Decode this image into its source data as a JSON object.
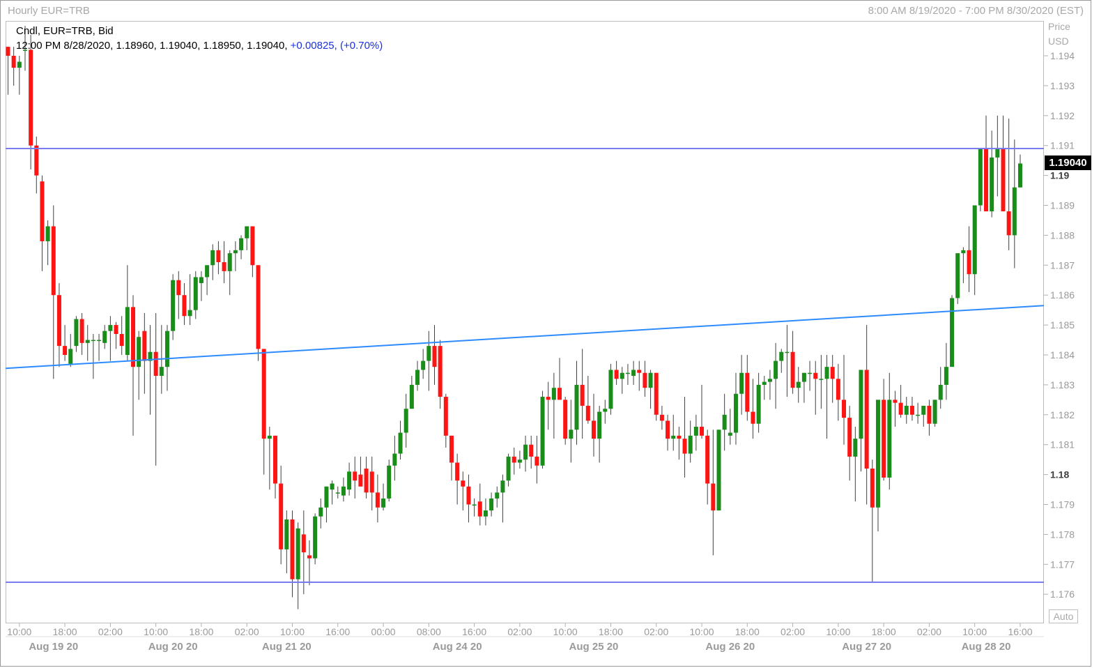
{
  "header": {
    "title": "Hourly EUR=TRB",
    "date_range": "8:00 AM 8/19/2020 - 7:00 PM 8/30/2020 (EST)"
  },
  "info": {
    "line1": "Cndl, EUR=TRB, Bid",
    "line2_prefix": "12:00 PM 8/28/2020, 1.18960, 1.19040, 1.18950, 1.19040,",
    "line2_change": "+0.00825, (+0.70%)"
  },
  "axis": {
    "price_label": "Price",
    "currency_label": "USD",
    "last_price": "1.19040",
    "auto_label": "Auto"
  },
  "colors": {
    "up": "#1a8c1a",
    "down": "#ff1414",
    "hline": "#7b7bf0",
    "trend": "#2e8bff"
  },
  "chart_data": {
    "type": "candlestick",
    "title": "Hourly EUR=TRB",
    "ylabel": "Price USD",
    "ylim": [
      1.1755,
      1.1948
    ],
    "y_ticks": [
      "1.176",
      "1.177",
      "1.178",
      "1.179",
      "1.18",
      "1.181",
      "1.182",
      "1.183",
      "1.184",
      "1.185",
      "1.186",
      "1.187",
      "1.188",
      "1.189",
      "1.19",
      "1.191",
      "1.192",
      "1.193",
      "1.194"
    ],
    "y_ticks_bold": [
      "1.18",
      "1.19"
    ],
    "x_ticks": [
      {
        "i": 2,
        "label": "10:00"
      },
      {
        "i": 10,
        "label": "18:00"
      },
      {
        "i": 18,
        "label": "02:00"
      },
      {
        "i": 26,
        "label": "10:00"
      },
      {
        "i": 34,
        "label": "18:00"
      },
      {
        "i": 42,
        "label": "02:00"
      },
      {
        "i": 50,
        "label": "10:00"
      },
      {
        "i": 58,
        "label": "16:00"
      },
      {
        "i": 66,
        "label": "00:00"
      },
      {
        "i": 74,
        "label": "08:00"
      },
      {
        "i": 82,
        "label": "16:00"
      },
      {
        "i": 90,
        "label": "02:00"
      },
      {
        "i": 98,
        "label": "10:00"
      },
      {
        "i": 106,
        "label": "18:00"
      },
      {
        "i": 114,
        "label": "02:00"
      },
      {
        "i": 122,
        "label": "10:00"
      },
      {
        "i": 130,
        "label": "18:00"
      },
      {
        "i": 138,
        "label": "02:00"
      },
      {
        "i": 146,
        "label": "10:00"
      },
      {
        "i": 154,
        "label": "18:00"
      },
      {
        "i": 162,
        "label": "02:00"
      },
      {
        "i": 170,
        "label": "10:00"
      },
      {
        "i": 178,
        "label": "16:00"
      }
    ],
    "x_dates": [
      {
        "i": 8,
        "label": "Aug 19 20"
      },
      {
        "i": 29,
        "label": "Aug 20 20"
      },
      {
        "i": 49,
        "label": "Aug 21 20"
      },
      {
        "i": 79,
        "label": "Aug 24 20"
      },
      {
        "i": 103,
        "label": "Aug 25 20"
      },
      {
        "i": 127,
        "label": "Aug 26 20"
      },
      {
        "i": 151,
        "label": "Aug 27 20"
      },
      {
        "i": 172,
        "label": "Aug 28 20"
      }
    ],
    "horizontal_lines": [
      1.1909,
      1.1764
    ],
    "trend_line": {
      "start": [
        0,
        1.18355
      ],
      "end": [
        181,
        1.18565
      ]
    },
    "candles": [
      [
        1.1943,
        1.1943,
        1.1927,
        1.194
      ],
      [
        1.194,
        1.1943,
        1.193,
        1.1936
      ],
      [
        1.1936,
        1.194,
        1.1927,
        1.1938
      ],
      [
        1.1942,
        1.195,
        1.1935,
        1.1942
      ],
      [
        1.1942,
        1.1947,
        1.1902,
        1.191
      ],
      [
        1.191,
        1.1913,
        1.1894,
        1.19
      ],
      [
        1.1898,
        1.19,
        1.1868,
        1.1878
      ],
      [
        1.1878,
        1.1885,
        1.187,
        1.1883
      ],
      [
        1.1883,
        1.189,
        1.1832,
        1.186
      ],
      [
        1.186,
        1.1864,
        1.1836,
        1.1843
      ],
      [
        1.1843,
        1.185,
        1.1838,
        1.184
      ],
      [
        1.1837,
        1.1847,
        1.1836,
        1.1842
      ],
      [
        1.1843,
        1.1853,
        1.1841,
        1.1852
      ],
      [
        1.1852,
        1.1854,
        1.184,
        1.1844
      ],
      [
        1.1844,
        1.185,
        1.1838,
        1.1845
      ],
      [
        1.1845,
        1.1847,
        1.1832,
        1.1845
      ],
      [
        1.1845,
        1.1847,
        1.1838,
        1.1845
      ],
      [
        1.1844,
        1.185,
        1.1842,
        1.1848
      ],
      [
        1.1848,
        1.1853,
        1.1838,
        1.185
      ],
      [
        1.185,
        1.1851,
        1.1842,
        1.1847
      ],
      [
        1.1847,
        1.1853,
        1.184,
        1.1843
      ],
      [
        1.184,
        1.187,
        1.1838,
        1.1856
      ],
      [
        1.1856,
        1.186,
        1.1813,
        1.1836
      ],
      [
        1.1836,
        1.1848,
        1.1825,
        1.1846
      ],
      [
        1.1848,
        1.1854,
        1.1827,
        1.1838
      ],
      [
        1.1838,
        1.185,
        1.182,
        1.1841
      ],
      [
        1.1841,
        1.1854,
        1.1803,
        1.1833
      ],
      [
        1.1833,
        1.185,
        1.1827,
        1.1836
      ],
      [
        1.1836,
        1.185,
        1.1828,
        1.1848
      ],
      [
        1.1848,
        1.1867,
        1.1845,
        1.1865
      ],
      [
        1.1865,
        1.1868,
        1.1852,
        1.186
      ],
      [
        1.186,
        1.1864,
        1.185,
        1.1853
      ],
      [
        1.1853,
        1.1867,
        1.185,
        1.1855
      ],
      [
        1.1855,
        1.1868,
        1.1852,
        1.1866
      ],
      [
        1.1864,
        1.1868,
        1.1858,
        1.1866
      ],
      [
        1.1866,
        1.187,
        1.186,
        1.187
      ],
      [
        1.187,
        1.1877,
        1.1865,
        1.1875
      ],
      [
        1.1875,
        1.1878,
        1.1867,
        1.1871
      ],
      [
        1.1871,
        1.1878,
        1.1864,
        1.1868
      ],
      [
        1.1868,
        1.1875,
        1.186,
        1.1874
      ],
      [
        1.1874,
        1.1878,
        1.1868,
        1.1875
      ],
      [
        1.1875,
        1.188,
        1.1872,
        1.1879
      ],
      [
        1.1879,
        1.1883,
        1.1875,
        1.1883
      ],
      [
        1.1883,
        1.1883,
        1.1866,
        1.187
      ],
      [
        1.187,
        1.187,
        1.1838,
        1.1842
      ],
      [
        1.1842,
        1.1842,
        1.18,
        1.1812
      ],
      [
        1.1812,
        1.1816,
        1.1795,
        1.1813
      ],
      [
        1.1813,
        1.1813,
        1.1792,
        1.1797
      ],
      [
        1.1797,
        1.1803,
        1.177,
        1.1775
      ],
      [
        1.1775,
        1.1788,
        1.1767,
        1.1785
      ],
      [
        1.1785,
        1.1788,
        1.1759,
        1.1765
      ],
      [
        1.1765,
        1.1784,
        1.1755,
        1.1782
      ],
      [
        1.178,
        1.1788,
        1.176,
        1.1774
      ],
      [
        1.1773,
        1.1778,
        1.1763,
        1.1772
      ],
      [
        1.1772,
        1.1787,
        1.177,
        1.1786
      ],
      [
        1.1786,
        1.1792,
        1.1782,
        1.1789
      ],
      [
        1.1789,
        1.1796,
        1.1784,
        1.1796
      ],
      [
        1.1795,
        1.1798,
        1.179,
        1.1797
      ],
      [
        1.1794,
        1.1796,
        1.1792,
        1.1794
      ],
      [
        1.1793,
        1.1799,
        1.1791,
        1.1796
      ],
      [
        1.1795,
        1.1804,
        1.1793,
        1.1801
      ],
      [
        1.1801,
        1.1806,
        1.1792,
        1.1798
      ],
      [
        1.18,
        1.1806,
        1.1796,
        1.1796
      ],
      [
        1.1802,
        1.1806,
        1.1792,
        1.1794
      ],
      [
        1.1801,
        1.1806,
        1.1788,
        1.1794
      ],
      [
        1.1794,
        1.18,
        1.1784,
        1.1789
      ],
      [
        1.1789,
        1.1797,
        1.1788,
        1.1792
      ],
      [
        1.1792,
        1.1805,
        1.1791,
        1.1803
      ],
      [
        1.1803,
        1.1813,
        1.1798,
        1.1807
      ],
      [
        1.1807,
        1.1818,
        1.1805,
        1.1814
      ],
      [
        1.1814,
        1.1827,
        1.1809,
        1.1822
      ],
      [
        1.1822,
        1.1833,
        1.1822,
        1.183
      ],
      [
        1.183,
        1.1838,
        1.1828,
        1.1835
      ],
      [
        1.1835,
        1.1842,
        1.1832,
        1.1838
      ],
      [
        1.1838,
        1.1848,
        1.1828,
        1.1843
      ],
      [
        1.1843,
        1.185,
        1.183,
        1.1836
      ],
      [
        1.1843,
        1.1845,
        1.1822,
        1.1826
      ],
      [
        1.1826,
        1.1827,
        1.1809,
        1.1813
      ],
      [
        1.1813,
        1.1813,
        1.1798,
        1.1804
      ],
      [
        1.1804,
        1.1807,
        1.179,
        1.1798
      ],
      [
        1.1798,
        1.1801,
        1.1788,
        1.1796
      ],
      [
        1.1796,
        1.18,
        1.1784,
        1.179
      ],
      [
        1.179,
        1.1792,
        1.1786,
        1.179
      ],
      [
        1.1791,
        1.1797,
        1.1783,
        1.1786
      ],
      [
        1.1786,
        1.1792,
        1.1783,
        1.1788
      ],
      [
        1.1788,
        1.1794,
        1.1786,
        1.1792
      ],
      [
        1.1792,
        1.1796,
        1.1789,
        1.1794
      ],
      [
        1.1794,
        1.18,
        1.1784,
        1.1798
      ],
      [
        1.1798,
        1.1807,
        1.1796,
        1.1806
      ],
      [
        1.1806,
        1.1809,
        1.18,
        1.1804
      ],
      [
        1.1804,
        1.1808,
        1.1802,
        1.1805
      ],
      [
        1.1805,
        1.1813,
        1.1801,
        1.181
      ],
      [
        1.181,
        1.1813,
        1.1802,
        1.1806
      ],
      [
        1.1806,
        1.1813,
        1.1797,
        1.1803
      ],
      [
        1.1803,
        1.1828,
        1.1802,
        1.1826
      ],
      [
        1.1826,
        1.1831,
        1.1815,
        1.1825
      ],
      [
        1.1825,
        1.1834,
        1.1812,
        1.1829
      ],
      [
        1.1829,
        1.1839,
        1.1825,
        1.1825
      ],
      [
        1.1825,
        1.1826,
        1.181,
        1.1812
      ],
      [
        1.1812,
        1.1825,
        1.1804,
        1.1815
      ],
      [
        1.1815,
        1.1838,
        1.181,
        1.183
      ],
      [
        1.183,
        1.1842,
        1.1812,
        1.1823
      ],
      [
        1.1823,
        1.1833,
        1.1817,
        1.1818
      ],
      [
        1.1818,
        1.1827,
        1.1806,
        1.1812
      ],
      [
        1.1812,
        1.1823,
        1.1804,
        1.1821
      ],
      [
        1.1821,
        1.1825,
        1.1817,
        1.1822
      ],
      [
        1.1822,
        1.1837,
        1.182,
        1.1835
      ],
      [
        1.1835,
        1.1838,
        1.183,
        1.1832
      ],
      [
        1.1832,
        1.1836,
        1.1827,
        1.1834
      ],
      [
        1.1834,
        1.1837,
        1.183,
        1.1834
      ],
      [
        1.1833,
        1.1838,
        1.183,
        1.1835
      ],
      [
        1.1835,
        1.1838,
        1.1828,
        1.1834
      ],
      [
        1.1834,
        1.1838,
        1.1826,
        1.1829
      ],
      [
        1.1829,
        1.1835,
        1.1822,
        1.1834
      ],
      [
        1.1834,
        1.1834,
        1.1818,
        1.182
      ],
      [
        1.182,
        1.1823,
        1.1815,
        1.1818
      ],
      [
        1.1818,
        1.182,
        1.1808,
        1.1812
      ],
      [
        1.1812,
        1.182,
        1.1808,
        1.1813
      ],
      [
        1.1813,
        1.1816,
        1.1805,
        1.1812
      ],
      [
        1.1812,
        1.1826,
        1.1799,
        1.1807
      ],
      [
        1.1807,
        1.1818,
        1.1804,
        1.1813
      ],
      [
        1.1813,
        1.182,
        1.1808,
        1.1816
      ],
      [
        1.1816,
        1.183,
        1.1812,
        1.1813
      ],
      [
        1.1813,
        1.1815,
        1.179,
        1.1797
      ],
      [
        1.1797,
        1.1815,
        1.1773,
        1.1788
      ],
      [
        1.1788,
        1.1815,
        1.1788,
        1.1815
      ],
      [
        1.1815,
        1.1827,
        1.1808,
        1.182
      ],
      [
        1.1813,
        1.1822,
        1.181,
        1.1814
      ],
      [
        1.1814,
        1.1834,
        1.181,
        1.1827
      ],
      [
        1.1827,
        1.184,
        1.182,
        1.1834
      ],
      [
        1.1834,
        1.184,
        1.1818,
        1.1821
      ],
      [
        1.1821,
        1.1832,
        1.1812,
        1.1817
      ],
      [
        1.1817,
        1.1834,
        1.1814,
        1.183
      ],
      [
        1.183,
        1.1833,
        1.1825,
        1.1831
      ],
      [
        1.1831,
        1.1835,
        1.1825,
        1.1832
      ],
      [
        1.1832,
        1.1844,
        1.1822,
        1.1838
      ],
      [
        1.1838,
        1.1842,
        1.1834,
        1.1841
      ],
      [
        1.1841,
        1.185,
        1.1826,
        1.1841
      ],
      [
        1.1841,
        1.1848,
        1.1827,
        1.1829
      ],
      [
        1.1829,
        1.1836,
        1.1824,
        1.1831
      ],
      [
        1.1831,
        1.1834,
        1.1824,
        1.1834
      ],
      [
        1.1834,
        1.1838,
        1.1828,
        1.1834
      ],
      [
        1.1834,
        1.1838,
        1.182,
        1.1832
      ],
      [
        1.1832,
        1.184,
        1.1822,
        1.1832
      ],
      [
        1.1832,
        1.184,
        1.1812,
        1.1836
      ],
      [
        1.1836,
        1.184,
        1.1824,
        1.1832
      ],
      [
        1.1832,
        1.1837,
        1.1818,
        1.1825
      ],
      [
        1.1825,
        1.184,
        1.181,
        1.1819
      ],
      [
        1.1819,
        1.1823,
        1.1798,
        1.1806
      ],
      [
        1.1806,
        1.1816,
        1.1791,
        1.1812
      ],
      [
        1.1812,
        1.1835,
        1.1801,
        1.1835
      ],
      [
        1.1835,
        1.185,
        1.179,
        1.1802
      ],
      [
        1.1802,
        1.1805,
        1.1764,
        1.1789
      ],
      [
        1.1789,
        1.1825,
        1.1781,
        1.1825
      ],
      [
        1.1825,
        1.1832,
        1.1798,
        1.1799
      ],
      [
        1.1799,
        1.1834,
        1.1795,
        1.1825
      ],
      [
        1.1825,
        1.1828,
        1.1816,
        1.1824
      ],
      [
        1.1824,
        1.183,
        1.1819,
        1.182
      ],
      [
        1.182,
        1.1826,
        1.1817,
        1.1823
      ],
      [
        1.1823,
        1.1826,
        1.1818,
        1.182
      ],
      [
        1.182,
        1.1824,
        1.1817,
        1.182
      ],
      [
        1.182,
        1.1823,
        1.1816,
        1.1823
      ],
      [
        1.1823,
        1.1825,
        1.1813,
        1.1817
      ],
      [
        1.1817,
        1.1825,
        1.1816,
        1.1825
      ],
      [
        1.1825,
        1.1836,
        1.1822,
        1.183
      ],
      [
        1.183,
        1.1844,
        1.1825,
        1.1836
      ],
      [
        1.1836,
        1.186,
        1.1852,
        1.1859
      ],
      [
        1.1859,
        1.1874,
        1.1857,
        1.1874
      ],
      [
        1.1874,
        1.1876,
        1.1864,
        1.1875
      ],
      [
        1.1875,
        1.1883,
        1.1861,
        1.1867
      ],
      [
        1.1867,
        1.1878,
        1.186,
        1.189
      ],
      [
        1.189,
        1.1906,
        1.1888,
        1.1909
      ],
      [
        1.1909,
        1.192,
        1.1888,
        1.1888
      ],
      [
        1.1888,
        1.1915,
        1.1886,
        1.1906
      ],
      [
        1.1906,
        1.192,
        1.1893,
        1.1909
      ],
      [
        1.1909,
        1.192,
        1.189,
        1.1888
      ],
      [
        1.1888,
        1.1919,
        1.1875,
        1.188
      ],
      [
        1.188,
        1.1912,
        1.1869,
        1.1896
      ],
      [
        1.1896,
        1.1907,
        1.1896,
        1.1904
      ]
    ]
  }
}
